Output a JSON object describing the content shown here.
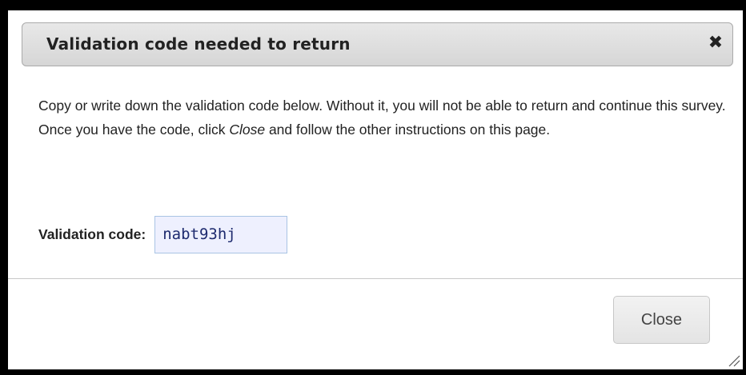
{
  "dialog": {
    "title": "Validation code needed to return",
    "close_icon": "close-x-icon",
    "instructions_before": "Copy or write down the validation code below. Without it, you will not be able to return and continue this survey. Once you have the code, click ",
    "instructions_emphasis": "Close",
    "instructions_after": " and follow the other instructions on this page.",
    "code_label": "Validation code:",
    "code_value": "nabt93hj",
    "close_button_label": "Close",
    "resize_icon": "resize-grip-icon"
  }
}
